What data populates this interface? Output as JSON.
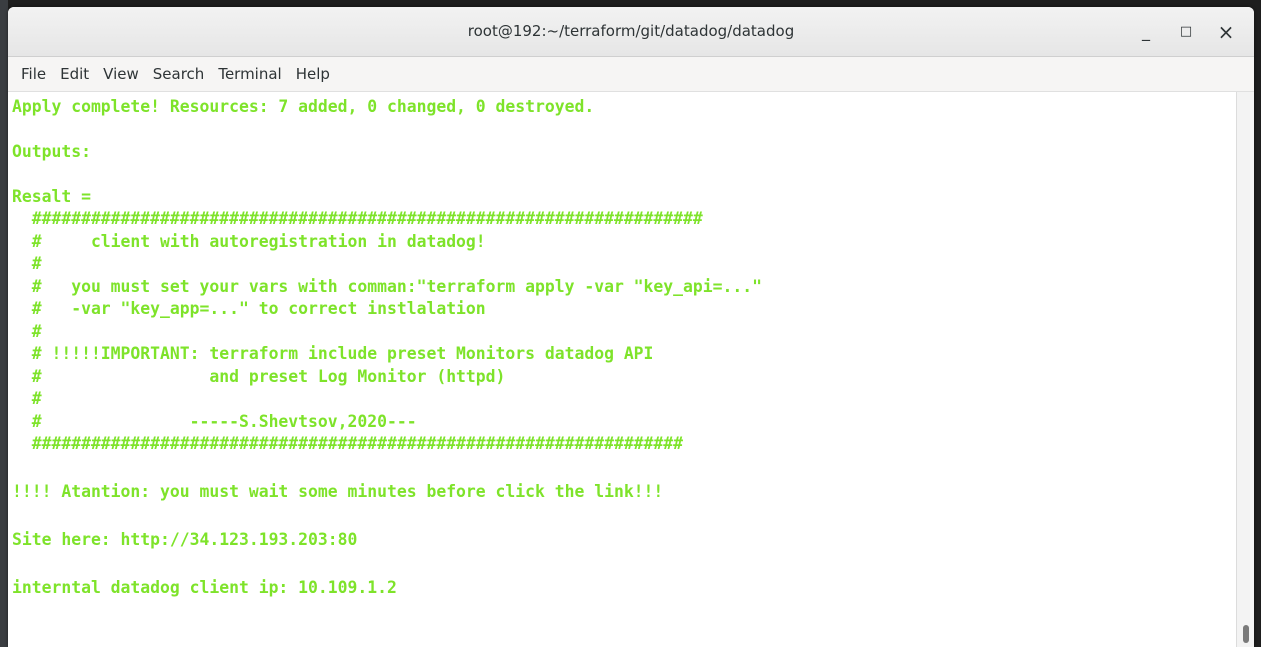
{
  "window": {
    "title": "root@192:~/terraform/git/datadog/datadog",
    "minimize_glyph": "_",
    "maximize_glyph": "□",
    "close_glyph": "×"
  },
  "menu": {
    "items": [
      "File",
      "Edit",
      "View",
      "Search",
      "Terminal",
      "Help"
    ]
  },
  "terminal": {
    "text_color": "#7ee32a",
    "lines": [
      "Apply complete! Resources: 7 added, 0 changed, 0 destroyed.",
      "",
      "Outputs:",
      "",
      "Resalt =",
      "  ####################################################################",
      "  #     client with autoregistration in datadog!",
      "  #",
      "  #   you must set your vars with comman:\"terraform apply -var \"key_api=...\"",
      "  #   -var \"key_app=...\" to correct instlalation",
      "  #",
      "  # !!!!!IMPORTANT: terraform include preset Monitors datadog API",
      "  #                 and preset Log Monitor (httpd)",
      "  #",
      "  #               -----S.Shevtsov,2020---",
      "  ##################################################################",
      "",
      "!!!! Atantion: you must wait some minutes before click the link!!!",
      "",
      "Site here: http://34.123.193.203:80",
      "",
      "interntal datadog client ip: 10.109.1.2"
    ]
  }
}
